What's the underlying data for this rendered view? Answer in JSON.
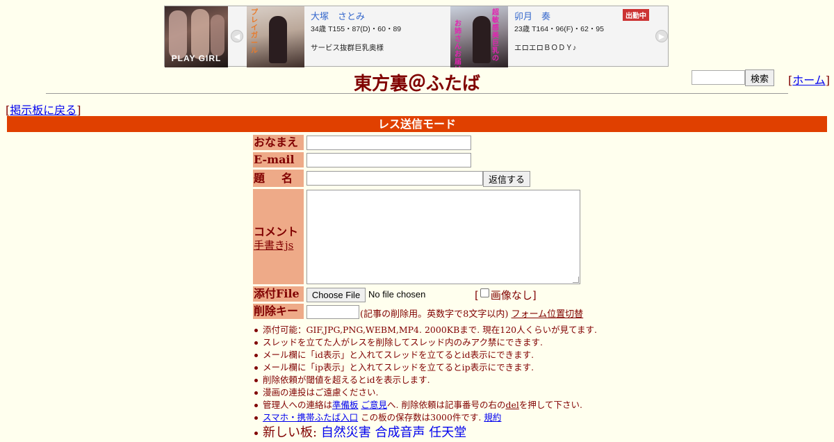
{
  "banner": {
    "logo_text": "PLAY GIRL",
    "girls": [
      {
        "name": "大塚　さとみ",
        "stats": "34歳 T155・87(D)・60・89",
        "desc": "サービス抜群巨乳奥様",
        "photo_caption": "プレイガール"
      },
      {
        "name": "卯月　奏",
        "stats": "23歳 T164・96(F)・62・95",
        "desc": "エロエロＢＯＤＹ♪",
        "badge": "出勤中",
        "photo_caption_1": "超敏感美巨乳の",
        "photo_caption_2": "お姉さんお届け"
      }
    ],
    "prev_icon": "chevron-left-icon",
    "next_icon": "chevron-right-icon"
  },
  "header": {
    "title": "東方裏＠ふたば",
    "search_button": "検索",
    "home_link": "ホーム",
    "back_link": "掲示板に戻る"
  },
  "mode_bar": "レス送信モード",
  "form": {
    "name_label": "おなまえ",
    "email_label": "E-mail",
    "subject_label_1": "題",
    "subject_label_2": "名",
    "reply_button": "返信する",
    "comment_label": "コメント",
    "handwriting_link": "手書きjs",
    "file_label": "添付File",
    "file_button": "Choose File",
    "file_status": "No file chosen",
    "no_image_label": "画像なし",
    "delkey_label": "削除キー",
    "delkey_note": "(記事の削除用。英数字で8文字以内)",
    "form_position_link": "フォーム位置切替",
    "values": {
      "name": "",
      "email": "",
      "subject": "",
      "comment": "",
      "delkey": ""
    }
  },
  "notes": {
    "n1": "添付可能：GIF,JPG,PNG,WEBM,MP4. 2000KBまで. 現在120人くらいが見てます.",
    "n2": "スレッドを立てた人がレスを削除してスレッド内のみアク禁にできます.",
    "n3": "メール欄に「id表示」と入れてスレッドを立てるとid表示にできます.",
    "n4": "メール欄に「ip表示」と入れてスレッドを立てるとip表示にできます.",
    "n5": "削除依頼が閾値を超えるとidを表示します.",
    "n6": "漫画の連投はご遠慮ください.",
    "n7_prefix": "管理人への連絡は",
    "n7_link1": "準備板",
    "n7_link2": "ご意見",
    "n7_mid": "へ. 削除依頼は記事番号の右の",
    "n7_del": "del",
    "n7_suffix": "を押して下さい.",
    "n8_link": "スマホ・携帯ふたば入口",
    "n8_text": "この板の保存数は3000件です.",
    "n8_rules": "規約",
    "n9_prefix": "新しい板:",
    "n9_link1": "自然災害",
    "n9_link2": "合成音声",
    "n9_link3": "任天堂"
  },
  "colors": {
    "background": "#ffffee",
    "text": "#800000",
    "mode_bar": "#e04000",
    "label_bg": "#eeaa88",
    "link": "#0000ee"
  }
}
